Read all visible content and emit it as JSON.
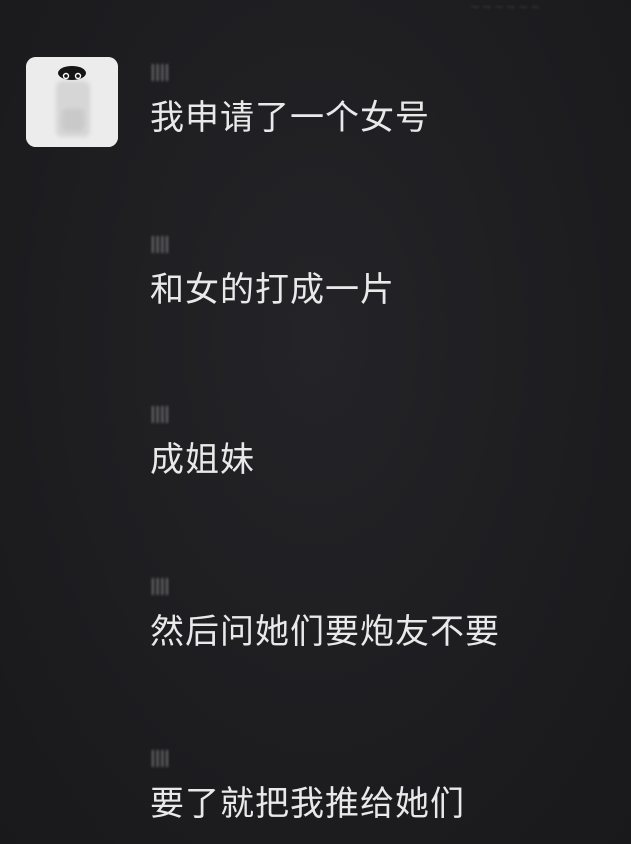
{
  "top_hint": "~~~~~~",
  "avatar": {
    "icon": "avatar-image"
  },
  "messages": [
    {
      "sender": "||||",
      "text": "我申请了一个女号"
    },
    {
      "sender": "||||",
      "text": "和女的打成一片"
    },
    {
      "sender": "||||",
      "text": "成姐妹"
    },
    {
      "sender": "||||",
      "text": "然后问她们要炮友不要"
    },
    {
      "sender": "||||",
      "text": "要了就把我推给她们"
    }
  ]
}
